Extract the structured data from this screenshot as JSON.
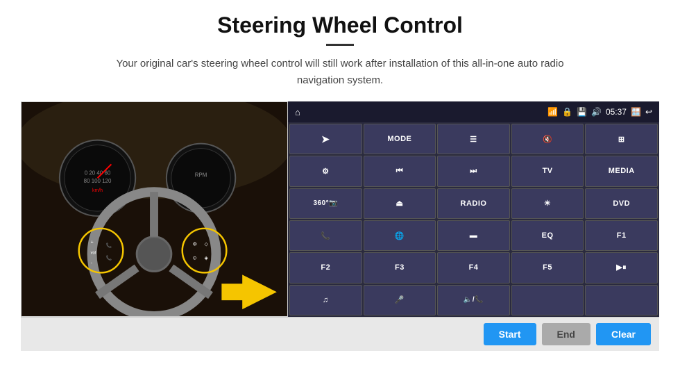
{
  "page": {
    "title": "Steering Wheel Control",
    "subtitle": "Your original car's steering wheel control will still work after installation of this all-in-one auto radio navigation system."
  },
  "statusBar": {
    "home": "⌂",
    "time": "05:37",
    "wifi": "📶",
    "lock": "🔒",
    "sd": "💳",
    "bt": "🔊",
    "window": "🪟",
    "back": "↩"
  },
  "buttons": [
    {
      "id": "nav",
      "label": "▲",
      "type": "icon",
      "symbol": "➤"
    },
    {
      "id": "mode",
      "label": "MODE",
      "type": "text"
    },
    {
      "id": "menu",
      "label": "☰",
      "type": "icon"
    },
    {
      "id": "mute",
      "label": "🔇",
      "type": "icon"
    },
    {
      "id": "apps",
      "label": "⊞",
      "type": "icon"
    },
    {
      "id": "settings",
      "label": "⚙",
      "type": "icon"
    },
    {
      "id": "prev",
      "label": "⏮",
      "type": "icon"
    },
    {
      "id": "next",
      "label": "⏭",
      "type": "icon"
    },
    {
      "id": "tv",
      "label": "TV",
      "type": "text"
    },
    {
      "id": "media",
      "label": "MEDIA",
      "type": "text"
    },
    {
      "id": "cam360",
      "label": "360°",
      "type": "text"
    },
    {
      "id": "eject",
      "label": "⏏",
      "type": "icon"
    },
    {
      "id": "radio",
      "label": "RADIO",
      "type": "text"
    },
    {
      "id": "brightness",
      "label": "☀",
      "type": "icon"
    },
    {
      "id": "dvd",
      "label": "DVD",
      "type": "text"
    },
    {
      "id": "phone",
      "label": "📞",
      "type": "icon"
    },
    {
      "id": "web",
      "label": "🌐",
      "type": "icon"
    },
    {
      "id": "screen",
      "label": "▬",
      "type": "icon"
    },
    {
      "id": "eq",
      "label": "EQ",
      "type": "text"
    },
    {
      "id": "f1",
      "label": "F1",
      "type": "text"
    },
    {
      "id": "f2",
      "label": "F2",
      "type": "text"
    },
    {
      "id": "f3",
      "label": "F3",
      "type": "text"
    },
    {
      "id": "f4",
      "label": "F4",
      "type": "text"
    },
    {
      "id": "f5",
      "label": "F5",
      "type": "text"
    },
    {
      "id": "playpause",
      "label": "▶⏸",
      "type": "icon"
    },
    {
      "id": "music",
      "label": "♫",
      "type": "icon"
    },
    {
      "id": "mic",
      "label": "🎤",
      "type": "icon"
    },
    {
      "id": "volphone",
      "label": "🔈/📞",
      "type": "icon"
    },
    {
      "id": "empty1",
      "label": "",
      "type": "empty"
    },
    {
      "id": "empty2",
      "label": "",
      "type": "empty"
    }
  ],
  "bottomBar": {
    "startLabel": "Start",
    "endLabel": "End",
    "clearLabel": "Clear"
  }
}
